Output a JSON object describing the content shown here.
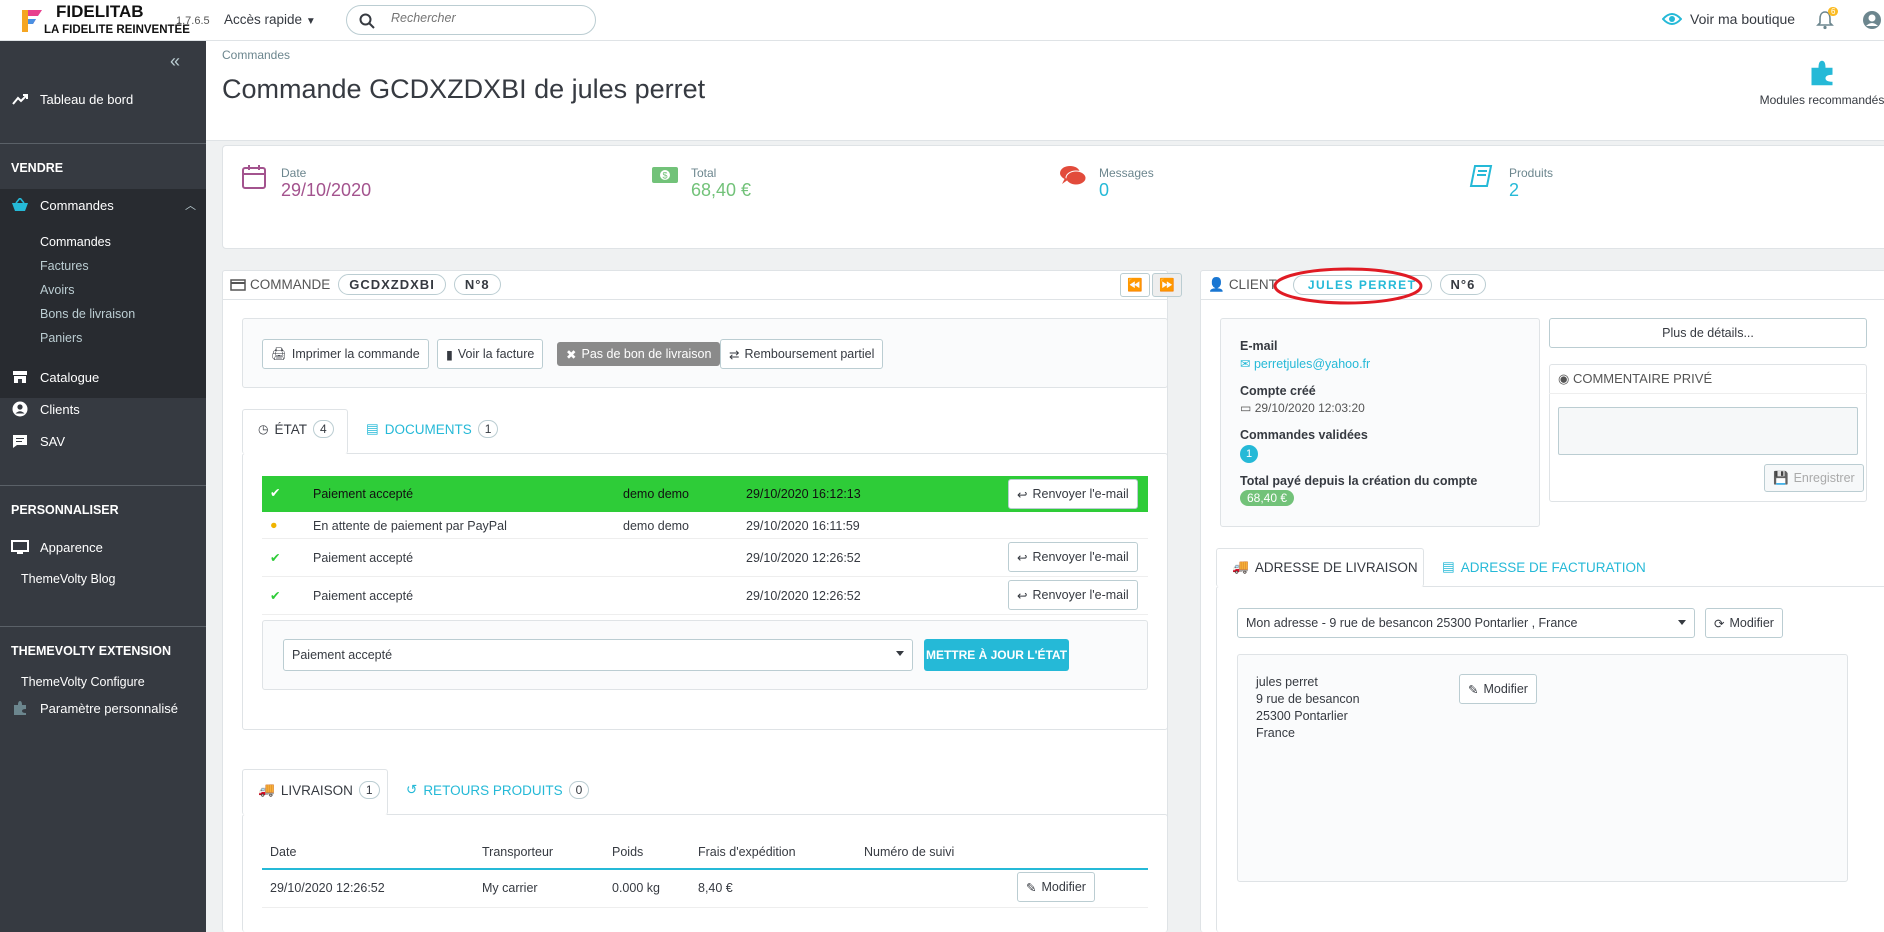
{
  "topbar": {
    "brand": "FIDELITAB",
    "tagline": "LA FIDELITE REINVENTÉE",
    "version": "1.7.6.5",
    "quick_access": "Accès rapide",
    "search_placeholder": "Rechercher",
    "view_shop": "Voir ma boutique",
    "notif_count": "6"
  },
  "sidebar": {
    "dashboard": "Tableau de bord",
    "sec_sell": "VENDRE",
    "orders": "Commandes",
    "sub": [
      "Commandes",
      "Factures",
      "Avoirs",
      "Bons de livraison",
      "Paniers"
    ],
    "catalog": "Catalogue",
    "clients": "Clients",
    "sav": "SAV",
    "sec_custom": "PERSONNALISER",
    "appearance": "Apparence",
    "themevolty_blog": "ThemeVolty Blog",
    "sec_ext": "THEMEVOLTY EXTENSION",
    "themevolty_configure": "ThemeVolty Configure",
    "custom_param": "Paramètre personnalisé"
  },
  "header": {
    "breadcrumb": "Commandes",
    "title": "Commande GCDXZDXBI de jules perret",
    "modules": "Modules recommandés"
  },
  "kpi": {
    "date_label": "Date",
    "date_value": "29/10/2020",
    "total_label": "Total",
    "total_value": "68,40 €",
    "messages_label": "Messages",
    "messages_value": "0",
    "products_label": "Produits",
    "products_value": "2"
  },
  "order": {
    "heading": "COMMANDE",
    "reference": "GCDXZDXBI",
    "number": "N°8",
    "print": "Imprimer la commande",
    "invoice": "Voir la facture",
    "no_delivery": "Pas de bon de livraison",
    "refund": "Remboursement partiel",
    "tab_state": "ÉTAT",
    "tab_state_count": "4",
    "tab_docs": "DOCUMENTS",
    "tab_docs_count": "1",
    "history": [
      {
        "status": "Paiement accepté",
        "employee": "demo demo",
        "date": "29/10/2020 16:12:13",
        "action": "Renvoyer l'e-mail"
      },
      {
        "status": "En attente de paiement par PayPal",
        "employee": "demo demo",
        "date": "29/10/2020 16:11:59",
        "action": ""
      },
      {
        "status": "Paiement accepté",
        "employee": "",
        "date": "29/10/2020 12:26:52",
        "action": "Renvoyer l'e-mail"
      },
      {
        "status": "Paiement accepté",
        "employee": "",
        "date": "29/10/2020 12:26:52",
        "action": "Renvoyer l'e-mail"
      }
    ],
    "state_select": "Paiement accepté",
    "update_state": "METTRE À JOUR L'ÉTAT",
    "tab_shipping": "LIVRAISON",
    "tab_shipping_count": "1",
    "tab_returns": "RETOURS PRODUITS",
    "tab_returns_count": "0",
    "ship_headers": [
      "Date",
      "Transporteur",
      "Poids",
      "Frais d'expédition",
      "Numéro de suivi"
    ],
    "ship_row": [
      "29/10/2020 12:26:52",
      "My carrier",
      "0.000 kg",
      "8,40 €",
      ""
    ],
    "ship_modify": "Modifier"
  },
  "client": {
    "heading": "CLIENT",
    "name": "JULES PERRET",
    "number": "N°6",
    "email_label": "E-mail",
    "email": "perretjules@yahoo.fr",
    "created_label": "Compte créé",
    "created": "29/10/2020 12:03:20",
    "orders_label": "Commandes validées",
    "orders_count": "1",
    "paid_label": "Total payé depuis la création du compte",
    "paid": "68,40 €",
    "more": "Plus de détails...",
    "comment_title": "COMMENTAIRE PRIVÉ",
    "save": "Enregistrer",
    "tab_delivery": "ADRESSE DE LIVRAISON",
    "tab_billing": "ADRESSE DE FACTURATION",
    "address_select": "Mon adresse - 9 rue de besancon 25300 Pontarlier , France",
    "modify": "Modifier",
    "address_lines": [
      "jules perret",
      "9 rue de besancon",
      "25300 Pontarlier",
      "France"
    ]
  },
  "colors": {
    "accent": "#25b9d7",
    "success": "#2ecc38",
    "sidebar": "#363a41",
    "highlight_ring": "#e01b24"
  }
}
